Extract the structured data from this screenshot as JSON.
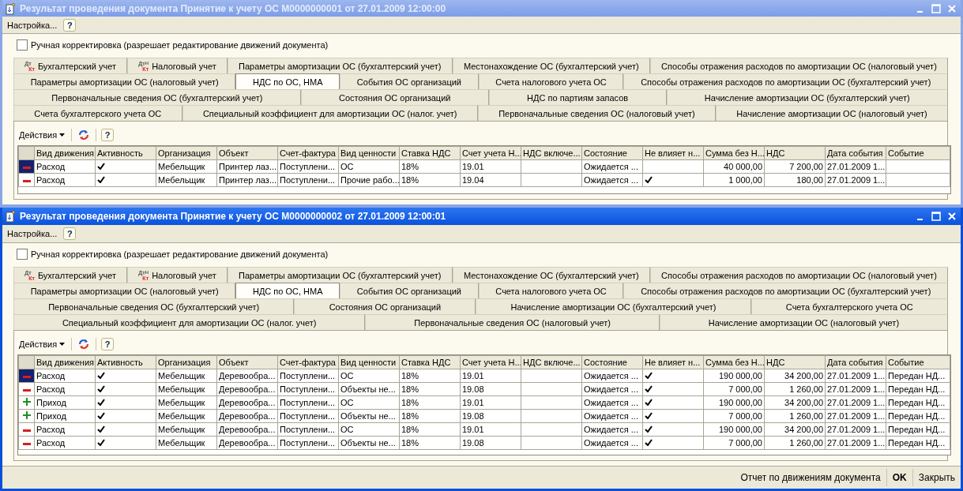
{
  "windows": [
    {
      "title": "Результат проведения документа Принятие к учету ОС М0000000001 от 27.01.2009 12:00:00",
      "active": false,
      "menu": {
        "settings": "Настройка...",
        "help": "?"
      },
      "manual_edit": {
        "label": "Ручная корректировка (разрешает редактирование движений документа)",
        "checked": false
      },
      "tab_rows": [
        [
          {
            "label": "Бухгалтерский учет",
            "selected": false,
            "icon": {
              "top": "Дт",
              "bottom": "Кт"
            }
          },
          {
            "label": "Налоговый учет",
            "selected": false,
            "icon": {
              "top": "Дт",
              "sup": "Н",
              "bottom": "Кт"
            }
          },
          {
            "label": "Параметры амортизации ОС (бухгалтерский учет)",
            "selected": false
          },
          {
            "label": "Местонахождение ОС (бухгалтерский учет)",
            "selected": false
          },
          {
            "label": "Способы отражения расходов по амортизации ОС (налоговый учет)",
            "selected": false
          }
        ],
        [
          {
            "label": "Параметры амортизации ОС (налоговый учет)",
            "selected": false
          },
          {
            "label": "НДС по ОС, НМА",
            "selected": true
          },
          {
            "label": "События ОС организаций",
            "selected": false
          },
          {
            "label": "Счета налогового учета ОС",
            "selected": false
          },
          {
            "label": "Способы отражения расходов по амортизации ОС (бухгалтерский учет)",
            "selected": false
          }
        ],
        [
          {
            "label": "Первоначальные сведения ОС (бухгалтерский учет)",
            "selected": false
          },
          {
            "label": "Состояния ОС организаций",
            "selected": false
          },
          {
            "label": "НДС по партиям запасов",
            "selected": false
          },
          {
            "label": "Начисление амортизации ОС (бухгалтерский учет)",
            "selected": false
          }
        ],
        [
          {
            "label": "Счета бухгалтерского учета ОС",
            "selected": false
          },
          {
            "label": "Специальный коэффициент для амортизации ОС (налог. учет)",
            "selected": false
          },
          {
            "label": "Первоначальные сведения ОС (налоговый учет)",
            "selected": false
          },
          {
            "label": "Начисление амортизации ОС (налоговый учет)",
            "selected": false
          }
        ]
      ],
      "toolbar": {
        "actions": "Действия",
        "help": "?"
      },
      "columns": [
        {
          "label": "Вид движения",
          "kind": "movement"
        },
        {
          "label": "Активность",
          "kind": "check"
        },
        {
          "label": "Организация",
          "kind": "text"
        },
        {
          "label": "Объект",
          "kind": "text"
        },
        {
          "label": "Счет-фактура",
          "kind": "text"
        },
        {
          "label": "Вид ценности",
          "kind": "text"
        },
        {
          "label": "Ставка НДС",
          "kind": "text"
        },
        {
          "label": "Счет учета Н...",
          "kind": "text"
        },
        {
          "label": "НДС включе...",
          "kind": "text"
        },
        {
          "label": "Состояние",
          "kind": "text"
        },
        {
          "label": "Не влияет н...",
          "kind": "check"
        },
        {
          "label": "Сумма без Н...",
          "kind": "number"
        },
        {
          "label": "НДС",
          "kind": "number"
        },
        {
          "label": "Дата события",
          "kind": "text"
        },
        {
          "label": "Событие",
          "kind": "text"
        }
      ],
      "rows": [
        {
          "selected": true,
          "kind": "minus",
          "cells": [
            "Расход",
            true,
            "Мебельщик",
            "Принтер лаз...",
            "Поступлени...",
            "ОС",
            "18%",
            "19.01",
            null,
            "Ожидается ...",
            false,
            "40 000,00",
            "7 200,00",
            "27.01.2009 1...",
            null
          ]
        },
        {
          "selected": false,
          "kind": "minus",
          "cells": [
            "Расход",
            true,
            "Мебельщик",
            "Принтер лаз...",
            "Поступлени...",
            "Прочие рабо...",
            "18%",
            "19.04",
            null,
            "Ожидается ...",
            true,
            "1 000,00",
            "180,00",
            "27.01.2009 1...",
            null
          ]
        }
      ]
    },
    {
      "title": "Результат проведения документа Принятие к учету ОС М0000000002 от 27.01.2009 12:00:01",
      "active": true,
      "menu": {
        "settings": "Настройка...",
        "help": "?"
      },
      "manual_edit": {
        "label": "Ручная корректировка (разрешает редактирование движений документа)",
        "checked": false
      },
      "tab_rows": [
        [
          {
            "label": "Бухгалтерский учет",
            "selected": false,
            "icon": {
              "top": "Дт",
              "bottom": "Кт"
            }
          },
          {
            "label": "Налоговый учет",
            "selected": false,
            "icon": {
              "top": "Дт",
              "sup": "Н",
              "bottom": "Кт"
            }
          },
          {
            "label": "Параметры амортизации ОС (бухгалтерский учет)",
            "selected": false
          },
          {
            "label": "Местонахождение ОС (бухгалтерский учет)",
            "selected": false
          },
          {
            "label": "Способы отражения расходов по амортизации ОС (налоговый учет)",
            "selected": false
          }
        ],
        [
          {
            "label": "Параметры амортизации ОС (налоговый учет)",
            "selected": false
          },
          {
            "label": "НДС по ОС, НМА",
            "selected": true
          },
          {
            "label": "События ОС организаций",
            "selected": false
          },
          {
            "label": "Счета налогового учета ОС",
            "selected": false
          },
          {
            "label": "Способы отражения расходов по амортизации ОС (бухгалтерский учет)",
            "selected": false
          }
        ],
        [
          {
            "label": "Первоначальные сведения ОС (бухгалтерский учет)",
            "selected": false
          },
          {
            "label": "Состояния ОС организаций",
            "selected": false
          },
          {
            "label": "Начисление амортизации ОС (бухгалтерский учет)",
            "selected": false
          },
          {
            "label": "Счета бухгалтерского учета ОС",
            "selected": false
          }
        ],
        [
          {
            "label": "Специальный коэффициент для амортизации ОС (налог. учет)",
            "selected": false
          },
          {
            "label": "Первоначальные сведения ОС (налоговый учет)",
            "selected": false
          },
          {
            "label": "Начисление амортизации ОС (налоговый учет)",
            "selected": false
          }
        ]
      ],
      "toolbar": {
        "actions": "Действия",
        "help": "?"
      },
      "columns": [
        {
          "label": "Вид движения",
          "kind": "movement"
        },
        {
          "label": "Активность",
          "kind": "check"
        },
        {
          "label": "Организация",
          "kind": "text"
        },
        {
          "label": "Объект",
          "kind": "text"
        },
        {
          "label": "Счет-фактура",
          "kind": "text"
        },
        {
          "label": "Вид ценности",
          "kind": "text"
        },
        {
          "label": "Ставка НДС",
          "kind": "text"
        },
        {
          "label": "Счет учета Н...",
          "kind": "text"
        },
        {
          "label": "НДС включе...",
          "kind": "text"
        },
        {
          "label": "Состояние",
          "kind": "text"
        },
        {
          "label": "Не влияет н...",
          "kind": "check"
        },
        {
          "label": "Сумма без Н...",
          "kind": "number"
        },
        {
          "label": "НДС",
          "kind": "number"
        },
        {
          "label": "Дата события",
          "kind": "text"
        },
        {
          "label": "Событие",
          "kind": "text"
        }
      ],
      "rows": [
        {
          "selected": true,
          "kind": "minus",
          "cells": [
            "Расход",
            true,
            "Мебельщик",
            "Деревообра...",
            "Поступлени...",
            "ОС",
            "18%",
            "19.01",
            null,
            "Ожидается ...",
            true,
            "190 000,00",
            "34 200,00",
            "27.01.2009 1...",
            "Передан НД..."
          ]
        },
        {
          "selected": false,
          "kind": "minus",
          "cells": [
            "Расход",
            true,
            "Мебельщик",
            "Деревообра...",
            "Поступлени...",
            "Объекты не...",
            "18%",
            "19.08",
            null,
            "Ожидается ...",
            true,
            "7 000,00",
            "1 260,00",
            "27.01.2009 1...",
            "Передан НД..."
          ]
        },
        {
          "selected": false,
          "kind": "plus",
          "cells": [
            "Приход",
            true,
            "Мебельщик",
            "Деревообра...",
            "Поступлени...",
            "ОС",
            "18%",
            "19.01",
            null,
            "Ожидается ...",
            true,
            "190 000,00",
            "34 200,00",
            "27.01.2009 1...",
            "Передан НД..."
          ]
        },
        {
          "selected": false,
          "kind": "plus",
          "cells": [
            "Приход",
            true,
            "Мебельщик",
            "Деревообра...",
            "Поступлени...",
            "Объекты не...",
            "18%",
            "19.08",
            null,
            "Ожидается ...",
            true,
            "7 000,00",
            "1 260,00",
            "27.01.2009 1...",
            "Передан НД..."
          ]
        },
        {
          "selected": false,
          "kind": "minus",
          "cells": [
            "Расход",
            true,
            "Мебельщик",
            "Деревообра...",
            "Поступлени...",
            "ОС",
            "18%",
            "19.01",
            null,
            "Ожидается ...",
            true,
            "190 000,00",
            "34 200,00",
            "27.01.2009 1...",
            "Передан НД..."
          ]
        },
        {
          "selected": false,
          "kind": "minus",
          "cells": [
            "Расход",
            true,
            "Мебельщик",
            "Деревообра...",
            "Поступлени...",
            "Объекты не...",
            "18%",
            "19.08",
            null,
            "Ожидается ...",
            true,
            "7 000,00",
            "1 260,00",
            "27.01.2009 1...",
            "Передан НД..."
          ]
        }
      ],
      "footer": {
        "report": "Отчет по движениям документа",
        "ok": "OK",
        "close": "Закрыть"
      }
    }
  ]
}
